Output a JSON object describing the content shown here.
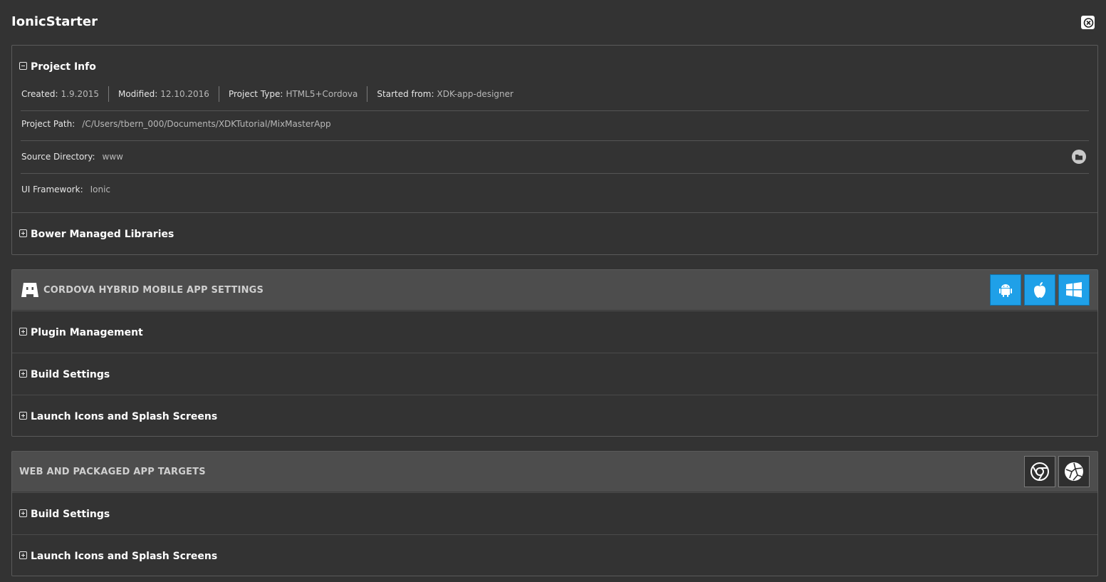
{
  "header": {
    "title": "IonicStarter",
    "close_icon": "close-icon"
  },
  "project_info": {
    "title": "Project Info",
    "created_label": "Created:",
    "created_value": "1.9.2015",
    "modified_label": "Modified:",
    "modified_value": "12.10.2016",
    "type_label": "Project Type:",
    "type_value": "HTML5+Cordova",
    "started_label": "Started from:",
    "started_value": "XDK-app-designer",
    "path_label": "Project Path:",
    "path_value": "/C/Users/tbern_000/Documents/XDKTutorial/MixMasterApp",
    "source_label": "Source Directory:",
    "source_value": "www",
    "framework_label": "UI Framework:",
    "framework_value": "Ionic",
    "bower_label": "Bower Managed Libraries"
  },
  "cordova": {
    "title": "CORDOVA HYBRID MOBILE APP SETTINGS",
    "platforms": [
      "android-icon",
      "apple-icon",
      "windows-icon"
    ],
    "accent": "#1fa0e8",
    "sections": {
      "plugins": "Plugin Management",
      "build": "Build Settings",
      "launch": "Launch Icons and Splash Screens"
    }
  },
  "web": {
    "title": "WEB AND PACKAGED APP TARGETS",
    "targets": [
      "chrome-icon",
      "crosswalk-icon"
    ],
    "sections": {
      "build": "Build Settings",
      "launch": "Launch Icons and Splash Screens"
    }
  }
}
